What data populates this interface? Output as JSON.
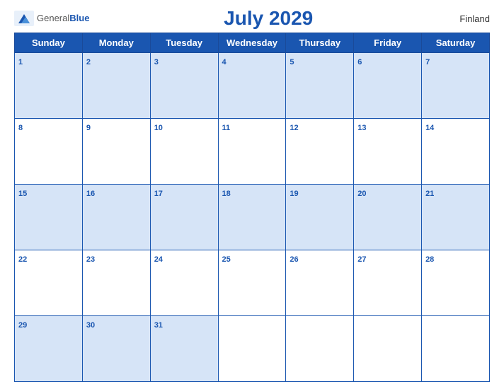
{
  "header": {
    "logo_general": "General",
    "logo_blue": "Blue",
    "title": "July 2029",
    "country": "Finland"
  },
  "days_of_week": [
    "Sunday",
    "Monday",
    "Tuesday",
    "Wednesday",
    "Thursday",
    "Friday",
    "Saturday"
  ],
  "weeks": [
    [
      1,
      2,
      3,
      4,
      5,
      6,
      7
    ],
    [
      8,
      9,
      10,
      11,
      12,
      13,
      14
    ],
    [
      15,
      16,
      17,
      18,
      19,
      20,
      21
    ],
    [
      22,
      23,
      24,
      25,
      26,
      27,
      28
    ],
    [
      29,
      30,
      31,
      null,
      null,
      null,
      null
    ]
  ],
  "colors": {
    "blue": "#1a56b0",
    "row_odd": "#d6e4f7",
    "row_even": "#ffffff"
  }
}
